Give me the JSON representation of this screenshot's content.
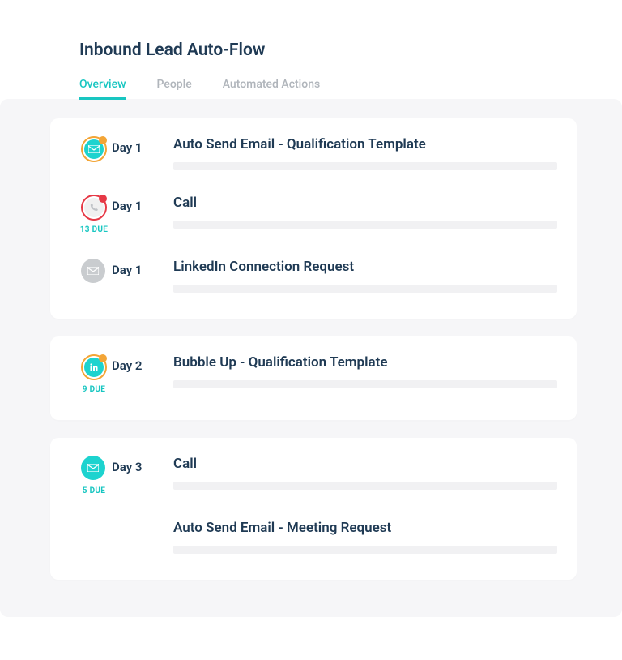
{
  "header": {
    "title": "Inbound Lead Auto-Flow",
    "tabs": [
      {
        "label": "Overview",
        "active": true
      },
      {
        "label": "People",
        "active": false
      },
      {
        "label": "Automated Actions",
        "active": false
      }
    ]
  },
  "cards": [
    {
      "steps": [
        {
          "icon": "email",
          "ring": "orange",
          "inner": "teal",
          "badge": "orange",
          "due": "",
          "day": "Day 1",
          "title": "Auto Send Email - Qualification Template"
        },
        {
          "icon": "phone",
          "ring": "red",
          "inner": "gray",
          "badge": "red",
          "due": "13 DUE",
          "day": "Day 1",
          "title": "Call"
        },
        {
          "icon": "email",
          "ring": "",
          "inner": "darkgray",
          "badge": "",
          "due": "",
          "day": "Day 1",
          "title": "LinkedIn Connection Request"
        }
      ]
    },
    {
      "steps": [
        {
          "icon": "linkedin",
          "ring": "orange",
          "inner": "teal",
          "badge": "orange",
          "due": "9 DUE",
          "day": "Day 2",
          "title": "Bubble Up - Qualification Template"
        }
      ]
    },
    {
      "steps": [
        {
          "icon": "email",
          "ring": "",
          "inner": "plain-teal",
          "badge": "",
          "due": "5 DUE",
          "day": "Day 3",
          "title": "Call"
        },
        {
          "icon": "",
          "ring": "",
          "inner": "",
          "badge": "",
          "due": "",
          "day": "",
          "title": "Auto Send Email - Meeting Request",
          "substep": true
        }
      ]
    }
  ]
}
